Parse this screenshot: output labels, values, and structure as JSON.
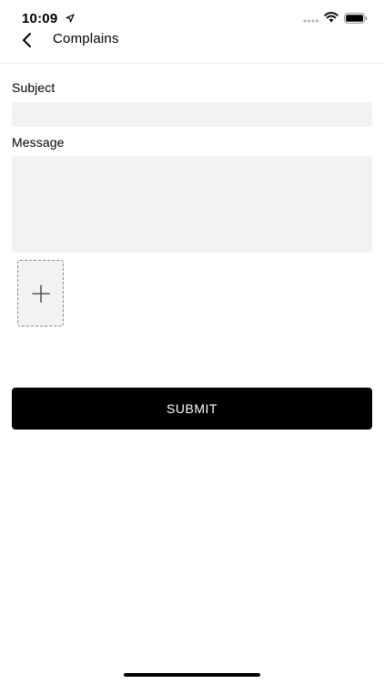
{
  "status_bar": {
    "time": "10:09",
    "icons": [
      "location-arrow-icon",
      "cell-signal-icon",
      "wifi-icon",
      "battery-icon"
    ]
  },
  "nav": {
    "title": "Complains",
    "back_icon": "chevron-left-icon"
  },
  "form": {
    "subject_label": "Subject",
    "subject_value": "",
    "message_label": "Message",
    "message_value": "",
    "attach_icon": "plus-icon"
  },
  "actions": {
    "submit_label": "SUBMIT"
  },
  "colors": {
    "background": "#ffffff",
    "input_fill": "#f2f2f2",
    "button_fill": "#000000",
    "button_text": "#ffffff",
    "dashed_border": "#8a8a8a"
  }
}
